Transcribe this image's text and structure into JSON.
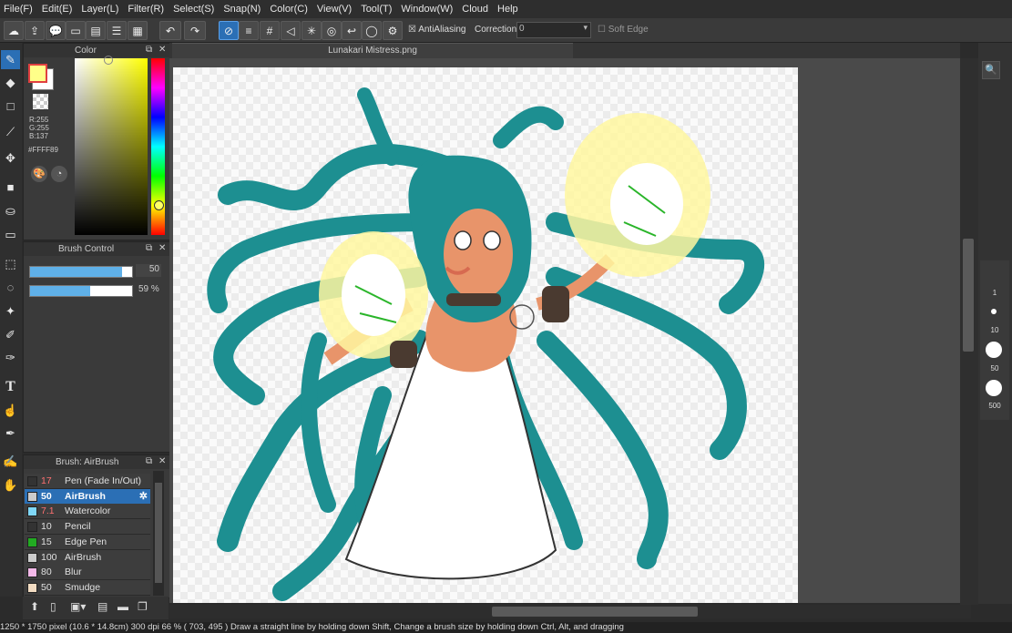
{
  "menu": [
    "File(F)",
    "Edit(E)",
    "Layer(L)",
    "Filter(R)",
    "Select(S)",
    "Snap(N)",
    "Color(C)",
    "View(V)",
    "Tool(T)",
    "Window(W)",
    "Cloud",
    "Help"
  ],
  "toolbar": {
    "antialiasing_label": "AntiAliasing",
    "correction_label": "Correction",
    "correction_value": "0",
    "soft_edge_label": "Soft Edge"
  },
  "color_panel": {
    "title": "Color",
    "r": "R:255",
    "g": "G:255",
    "b": "B:137",
    "hex": "#FFFF89",
    "foreground_color": "#ffff89",
    "background_color": "#ffffff"
  },
  "brush_control": {
    "title": "Brush Control",
    "size_value": "50",
    "size_fraction": 0.9,
    "opacity_value": "59 %",
    "opacity_fraction": 0.59
  },
  "brush_panel": {
    "title": "Brush: AirBrush",
    "brushes": [
      {
        "size": "17",
        "name": "Pen (Fade In/Out)",
        "color": "#333333",
        "size_color": "#ff7070"
      },
      {
        "size": "50",
        "name": "AirBrush",
        "color": "#cccccc",
        "size_color": "#ffffff"
      },
      {
        "size": "7.1",
        "name": "Watercolor",
        "color": "#7fd7f7",
        "size_color": "#ff7070"
      },
      {
        "size": "10",
        "name": "Pencil",
        "color": "#333333",
        "size_color": "#e0e0e0"
      },
      {
        "size": "15",
        "name": "Edge Pen",
        "color": "#22aa22",
        "size_color": "#e0e0e0"
      },
      {
        "size": "100",
        "name": "AirBrush",
        "color": "#cccccc",
        "size_color": "#e0e0e0"
      },
      {
        "size": "80",
        "name": "Blur",
        "color": "#f3b8e8",
        "size_color": "#e0e0e0"
      },
      {
        "size": "50",
        "name": "Smudge",
        "color": "#f2dcc2",
        "size_color": "#e0e0e0"
      }
    ]
  },
  "document": {
    "tab_title": "Lunakari Mistress.png"
  },
  "brush_sizes": [
    "1",
    "10",
    "50",
    "500"
  ],
  "status": "1250 * 1750 pixel  (10.6 * 14.8cm)  300 dpi  66 %  ( 703, 495 )  Draw a straight line by holding down Shift, Change a brush size by holding down Ctrl, Alt, and dragging",
  "colors": {
    "accent": "#2b6fb5",
    "hair": "#1d8f91",
    "glow": "#fff7a0",
    "skin": "#e8946a"
  }
}
